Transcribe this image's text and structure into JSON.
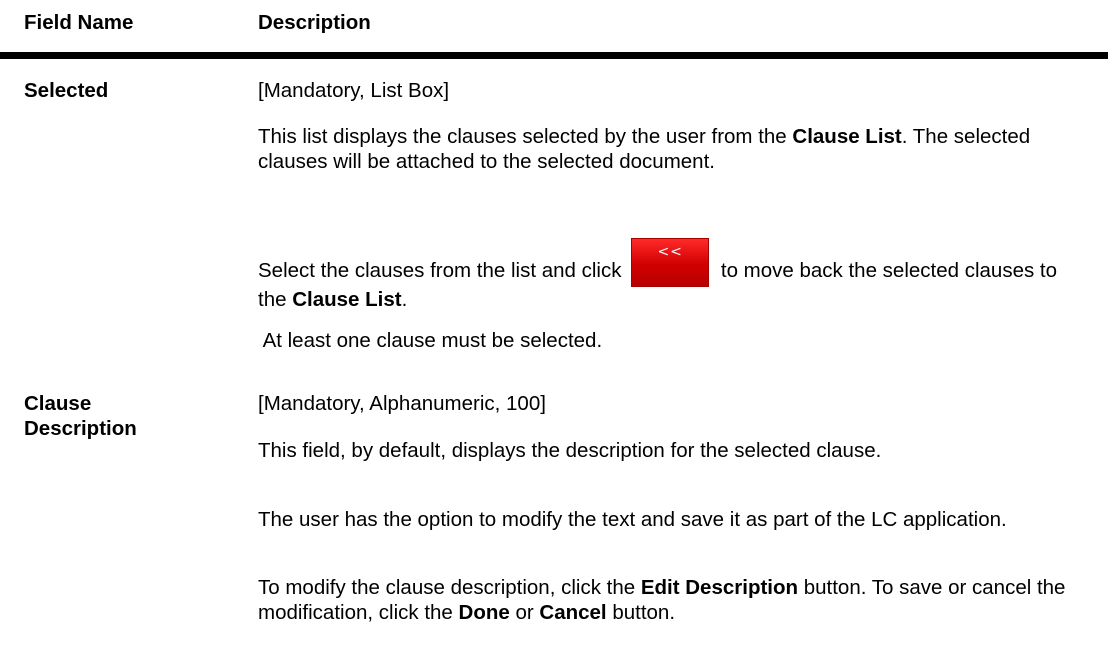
{
  "table": {
    "headers": {
      "field_name": "Field Name",
      "description": "Description"
    },
    "rows": [
      {
        "field": "Selected",
        "type": "[Mandatory, List Box]",
        "p1": {
          "a": "This list displays the clauses selected by the user from the ",
          "b": "Clause List",
          "c": ". The selected clauses will be attached to the selected document."
        },
        "p2": {
          "a": "Select the clauses from the list and click ",
          "btn": "<<",
          "b": " to move back the selected clauses to the ",
          "c": "Clause List",
          "d": "."
        },
        "p3": " At least one clause must be selected."
      },
      {
        "field_line1": "Clause",
        "field_line2": "Description",
        "type": "[Mandatory, Alphanumeric, 100]",
        "p1": "This field, by default, displays the description for the selected clause.",
        "p2": "The user has the option to modify the text and save it as part of the LC application.",
        "p3": {
          "a": "To modify the clause description, click the ",
          "b": "Edit Description",
          "c": " button. To save or cancel the modification, click the ",
          "d": "Done",
          "e": " or ",
          "f": "Cancel",
          "g": " button."
        }
      }
    ]
  },
  "colors": {
    "button_red": "#dd0000",
    "rule": "#000000"
  },
  "icons": {
    "move_back_button": "move-back-icon"
  }
}
